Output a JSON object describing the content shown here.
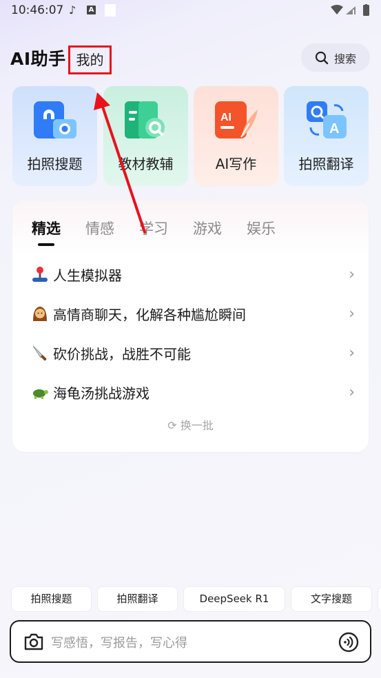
{
  "status_bar": {
    "time": "10:46:07"
  },
  "header": {
    "title": "AI助手",
    "tab_mine": "我的",
    "search_label": "搜索"
  },
  "tools": [
    {
      "label": "拍照搜题",
      "icon": "photo-search-icon"
    },
    {
      "label": "教材教辅",
      "icon": "textbook-icon"
    },
    {
      "label": "AI写作",
      "icon": "ai-writing-icon"
    },
    {
      "label": "拍照翻译",
      "icon": "photo-translate-icon"
    }
  ],
  "panel": {
    "tabs": [
      "精选",
      "情感",
      "学习",
      "游戏",
      "娱乐"
    ],
    "active_tab": "精选",
    "items": [
      {
        "emoji": "joystick",
        "text": "人生模拟器"
      },
      {
        "emoji": "woman",
        "text": "高情商聊天，化解各种尴尬瞬间"
      },
      {
        "emoji": "knife",
        "text": "砍价挑战，战胜不可能"
      },
      {
        "emoji": "turtle",
        "text": "海龟汤挑战游戏"
      }
    ],
    "refresh_label": "换一批"
  },
  "quick_chips": [
    "拍照搜题",
    "拍照翻译",
    "DeepSeek R1",
    "文字搜题"
  ],
  "input": {
    "placeholder": "写感悟，写报告，写心得"
  },
  "colors": {
    "annotation_red": "#e8121c",
    "accent_blue": "#2f7cf6"
  }
}
